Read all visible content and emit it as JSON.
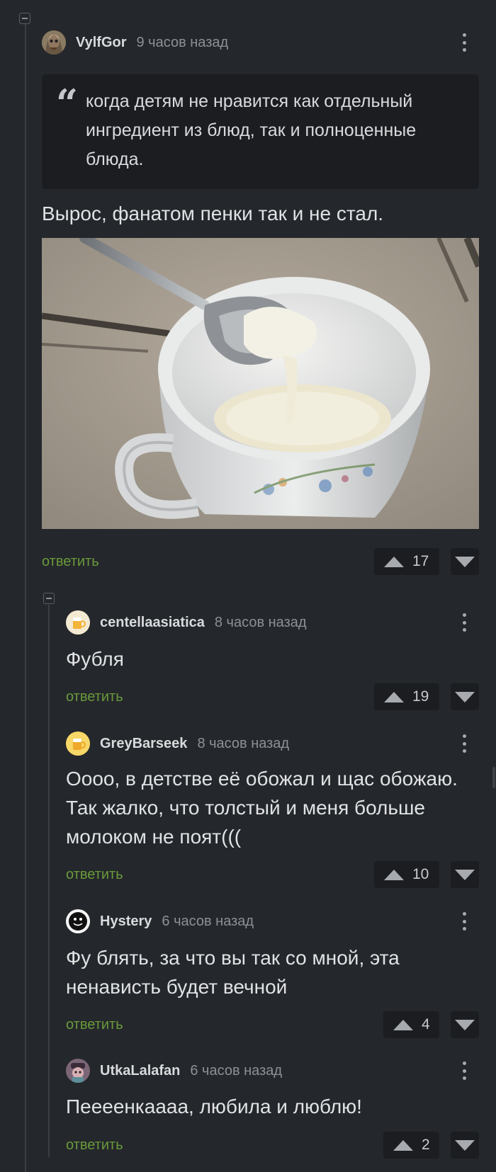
{
  "comments": [
    {
      "author": "VylfGor",
      "time": "9 часов назад",
      "quote": "когда детям не нравится как отдельный ингредиент из блюд, так и полноценные блюда.",
      "text": "Вырос, фанатом пенки так и не стал.",
      "reply_label": "ответить",
      "votes": "17",
      "avatar_icon": "user-avatar-icon",
      "image_subject": "spoon-with-milk-skin-over-cup"
    },
    {
      "author": "centellaasiatica",
      "time": "8 часов назад",
      "text": "Фубля",
      "reply_label": "ответить",
      "votes": "19",
      "avatar_icon": "beer-mug-avatar-icon"
    },
    {
      "author": "GreyBarseek",
      "time": "8 часов назад",
      "text": "Оооо, в детстве её обожал и щас обожаю. Так жалко, что толстый и меня больше молоком не поят(((",
      "reply_label": "ответить",
      "votes": "10",
      "avatar_icon": "beer-mug-avatar-icon"
    },
    {
      "author": "Hystery",
      "time": "6 часов назад",
      "text": "Фу блять, за что вы так со мной, эта ненависть будет вечной",
      "reply_label": "ответить",
      "votes": "4",
      "avatar_icon": "smiley-avatar-icon"
    },
    {
      "author": "UtkaLalafan",
      "time": "6 часов назад",
      "text": "Пеееенкаааа, любила и люблю!",
      "reply_label": "ответить",
      "votes": "2",
      "avatar_icon": "user-avatar-icon"
    }
  ],
  "colors": {
    "background": "#24272b",
    "quote_background": "#1b1d20",
    "reply_link": "#6a9a3b",
    "muted_text": "#8d9196"
  }
}
